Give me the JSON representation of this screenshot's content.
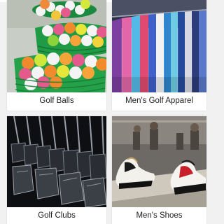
{
  "categories": [
    {
      "label": "Golf Balls",
      "image": "golf-balls-in-green-baskets"
    },
    {
      "label": "Men's Golf Apparel",
      "image": "shirts-on-rack"
    },
    {
      "label": "Golf Clubs",
      "image": "golf-club-heads"
    },
    {
      "label": "Men's Shoes",
      "image": "golf-shoes-on-display"
    }
  ]
}
